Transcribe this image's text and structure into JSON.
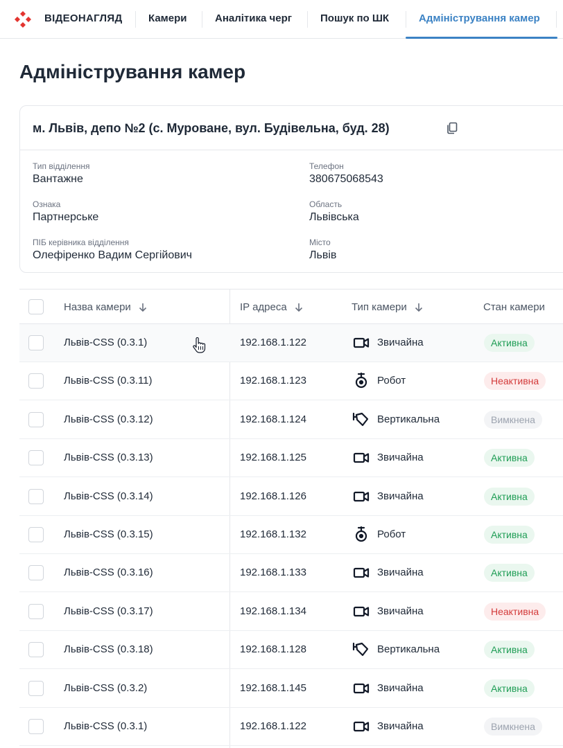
{
  "header": {
    "brand": "ВІДЕОНАГЛЯД",
    "tabs": [
      {
        "label": "Камери"
      },
      {
        "label": "Аналітика черг"
      },
      {
        "label": "Пошук по ШК"
      },
      {
        "label": "Адміністрування камер"
      }
    ],
    "active_tab": 3,
    "accent_color": "#3b82c4",
    "logo_color": "#e3342f"
  },
  "page": {
    "title": "Адміністрування камер"
  },
  "department": {
    "title": "м. Львів, депо №2 (с. Муроване, вул. Будівельна, буд. 28)",
    "copy_icon": "copy-icon",
    "fields": {
      "type": {
        "label": "Тип відділення",
        "value": "Вантажне"
      },
      "phone": {
        "label": "Телефон",
        "value": "380675068543"
      },
      "sign": {
        "label": "Ознака",
        "value": "Партнерське"
      },
      "region": {
        "label": "Область",
        "value": "Львівська"
      },
      "manager": {
        "label": "ПІБ керівника відділення",
        "value": "Олефіренко Вадим Сергійович"
      },
      "city": {
        "label": "Місто",
        "value": "Львів"
      }
    }
  },
  "table": {
    "columns": {
      "name": "Назва камери",
      "ip": "IP адреса",
      "type": "Тип камери",
      "status": "Стан камери"
    },
    "status_colors": {
      "active": "#1f9d55",
      "inactive": "#d33a3a",
      "off": "#9ca3af"
    },
    "rows": [
      {
        "name": "Львів-CSS (0.3.1)",
        "ip": "192.168.1.122",
        "type": "Звичайна",
        "icon": "video-camera-icon",
        "status": "Активна",
        "status_kind": "active"
      },
      {
        "name": "Львів-CSS (0.3.11)",
        "ip": "192.168.1.123",
        "type": "Робот",
        "icon": "robot-camera-icon",
        "status": "Неактивна",
        "status_kind": "inactive"
      },
      {
        "name": "Львів-CSS (0.3.12)",
        "ip": "192.168.1.124",
        "type": "Вертикальна",
        "icon": "vertical-camera-icon",
        "status": "Вимкнена",
        "status_kind": "off"
      },
      {
        "name": "Львів-CSS (0.3.13)",
        "ip": "192.168.1.125",
        "type": "Звичайна",
        "icon": "video-camera-icon",
        "status": "Активна",
        "status_kind": "active"
      },
      {
        "name": "Львів-CSS (0.3.14)",
        "ip": "192.168.1.126",
        "type": "Звичайна",
        "icon": "video-camera-icon",
        "status": "Активна",
        "status_kind": "active"
      },
      {
        "name": "Львів-CSS (0.3.15)",
        "ip": "192.168.1.132",
        "type": "Робот",
        "icon": "robot-camera-icon",
        "status": "Активна",
        "status_kind": "active"
      },
      {
        "name": "Львів-CSS (0.3.16)",
        "ip": "192.168.1.133",
        "type": "Звичайна",
        "icon": "video-camera-icon",
        "status": "Активна",
        "status_kind": "active"
      },
      {
        "name": "Львів-CSS (0.3.17)",
        "ip": "192.168.1.134",
        "type": "Звичайна",
        "icon": "video-camera-icon",
        "status": "Неактивна",
        "status_kind": "inactive"
      },
      {
        "name": "Львів-CSS (0.3.18)",
        "ip": "192.168.1.128",
        "type": "Вертикальна",
        "icon": "vertical-camera-icon",
        "status": "Активна",
        "status_kind": "active"
      },
      {
        "name": "Львів-CSS (0.3.2)",
        "ip": "192.168.1.145",
        "type": "Звичайна",
        "icon": "video-camera-icon",
        "status": "Активна",
        "status_kind": "active"
      },
      {
        "name": "Львів-CSS (0.3.1)",
        "ip": "192.168.1.122",
        "type": "Звичайна",
        "icon": "video-camera-icon",
        "status": "Вимкнена",
        "status_kind": "off"
      }
    ]
  }
}
